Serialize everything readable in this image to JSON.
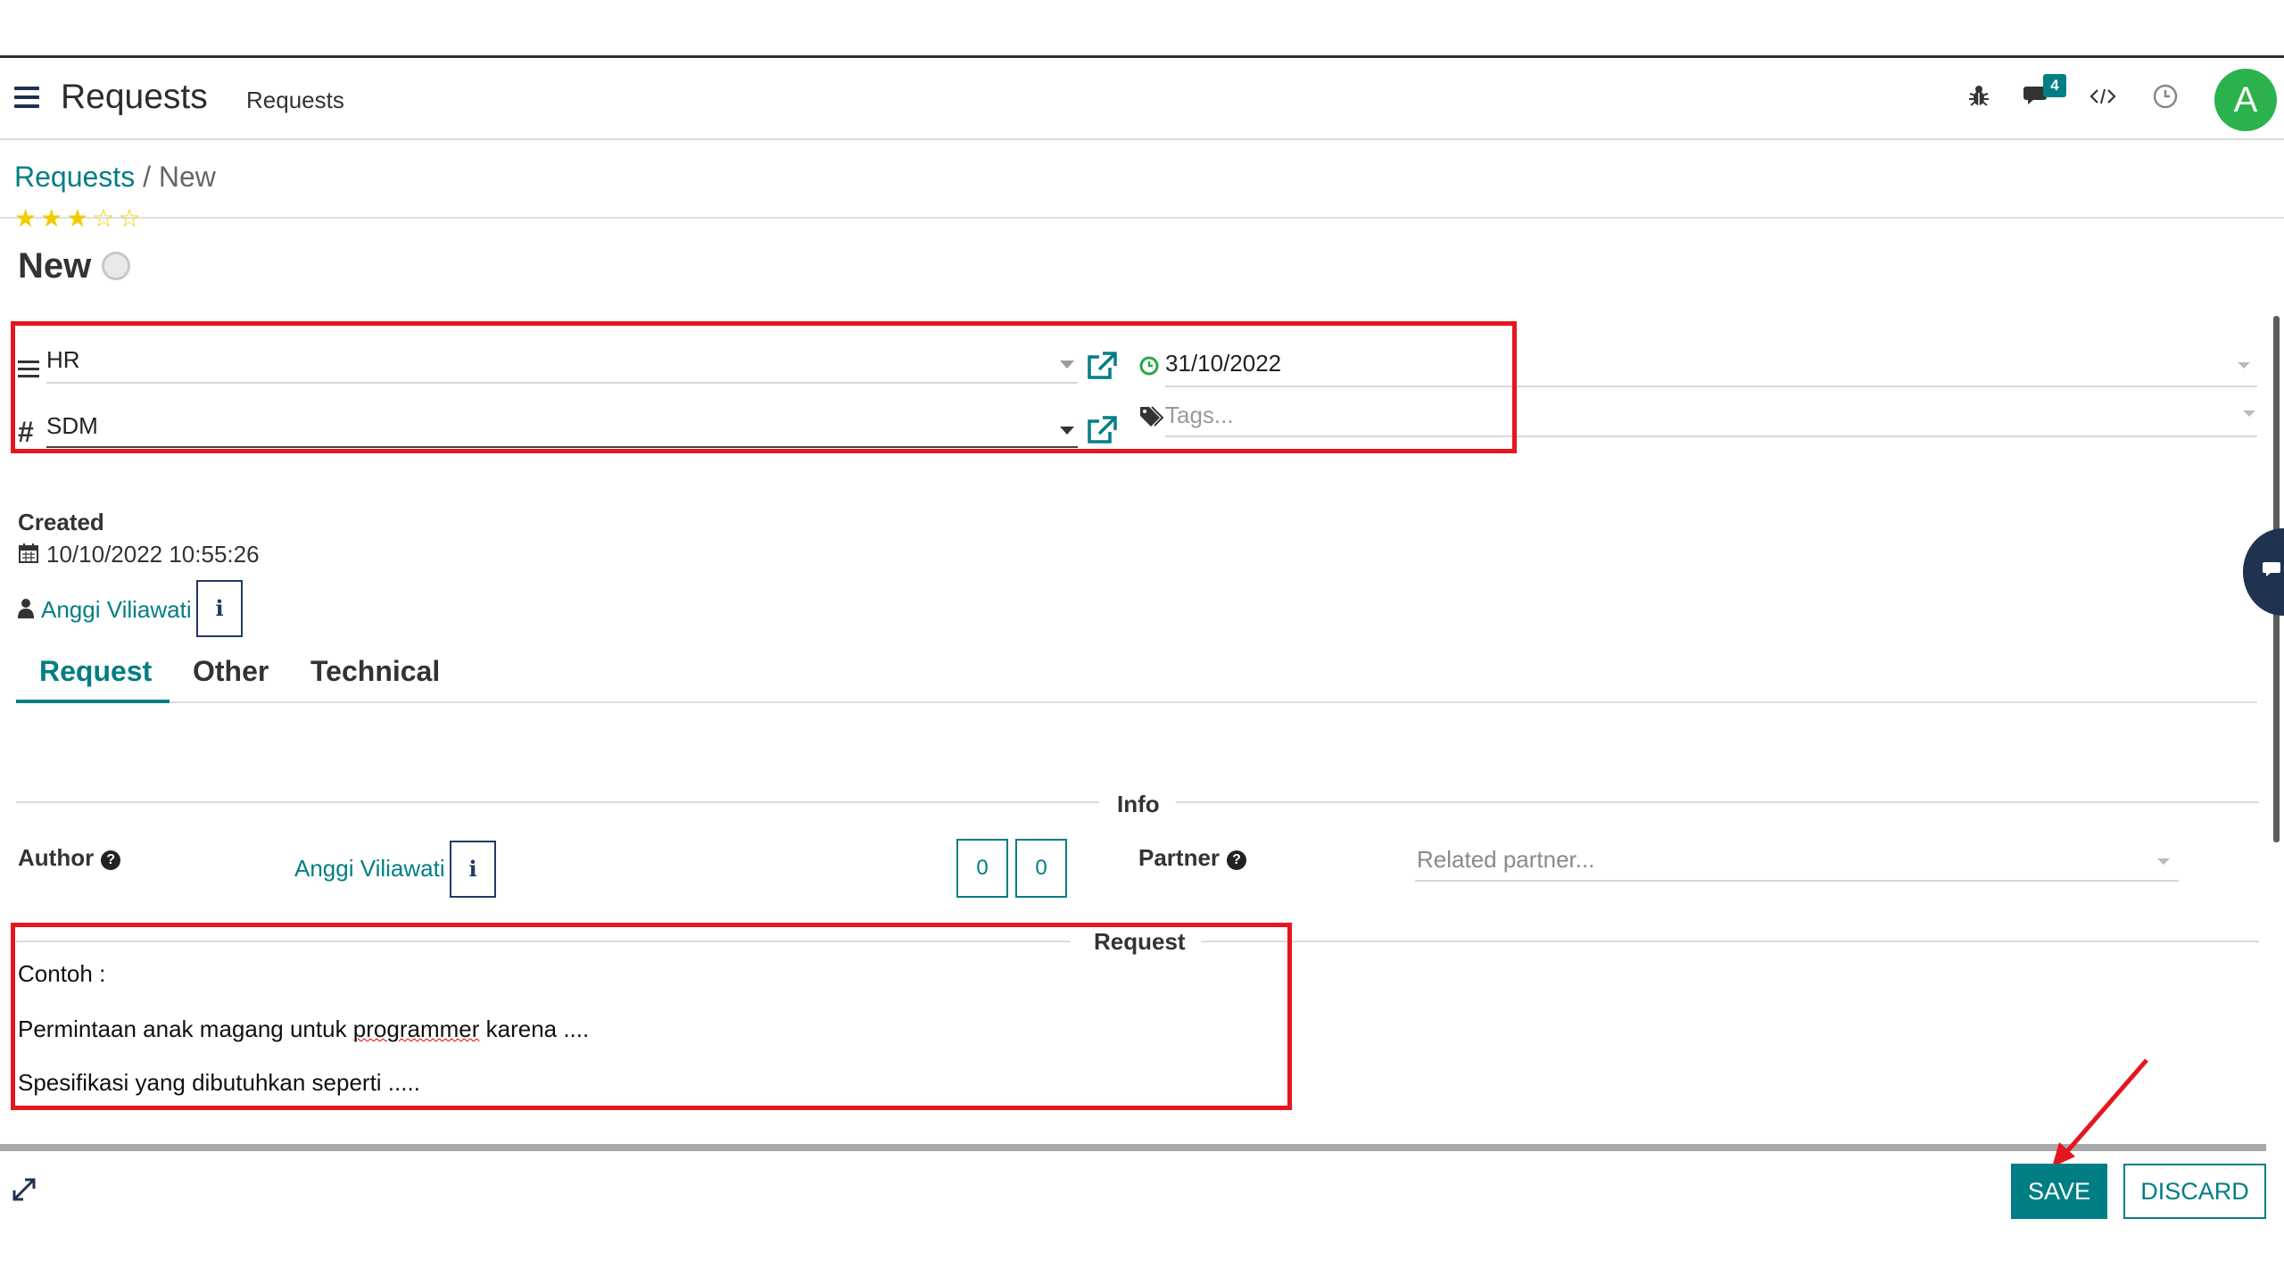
{
  "navbar": {
    "app_title": "Requests",
    "menu_item": "Requests",
    "chat_count": "4",
    "avatar_letter": "A",
    "icons": [
      "bug-icon",
      "chat-icon",
      "code-icon",
      "clock-icon"
    ]
  },
  "breadcrumb": {
    "parent": "Requests",
    "separator": "/",
    "current": "New"
  },
  "record": {
    "rating_filled": 3,
    "rating_max": 5,
    "title": "New"
  },
  "fields": {
    "category": "HR",
    "type": "SDM",
    "deadline": "31/10/2022",
    "tags_placeholder": "Tags..."
  },
  "created": {
    "label": "Created",
    "datetime": "10/10/2022 10:55:26",
    "user": "Anggi Viliawati",
    "info_symbol": "i"
  },
  "tabs": [
    {
      "label": "Request",
      "active": true
    },
    {
      "label": "Other",
      "active": false
    },
    {
      "label": "Technical",
      "active": false
    }
  ],
  "info_section": {
    "separator_label": "Info",
    "author_label": "Author",
    "author_value": "Anggi Viliawati",
    "info_symbol": "i",
    "counter_a": "0",
    "counter_b": "0",
    "partner_label": "Partner",
    "partner_placeholder": "Related partner..."
  },
  "request_section": {
    "separator_label": "Request",
    "line1": "Contoh :",
    "line2_before": "Permintaan anak magang untuk ",
    "line2_spell": "programmer",
    "line2_after": " karena ....",
    "line3": "Spesifikasi yang dibutuhkan seperti ....."
  },
  "actions": {
    "save": "SAVE",
    "discard": "DISCARD"
  },
  "colors": {
    "accent": "#017e84",
    "highlight_box": "#e5161f",
    "avatar": "#2bb24c",
    "star": "#f3cc00"
  }
}
